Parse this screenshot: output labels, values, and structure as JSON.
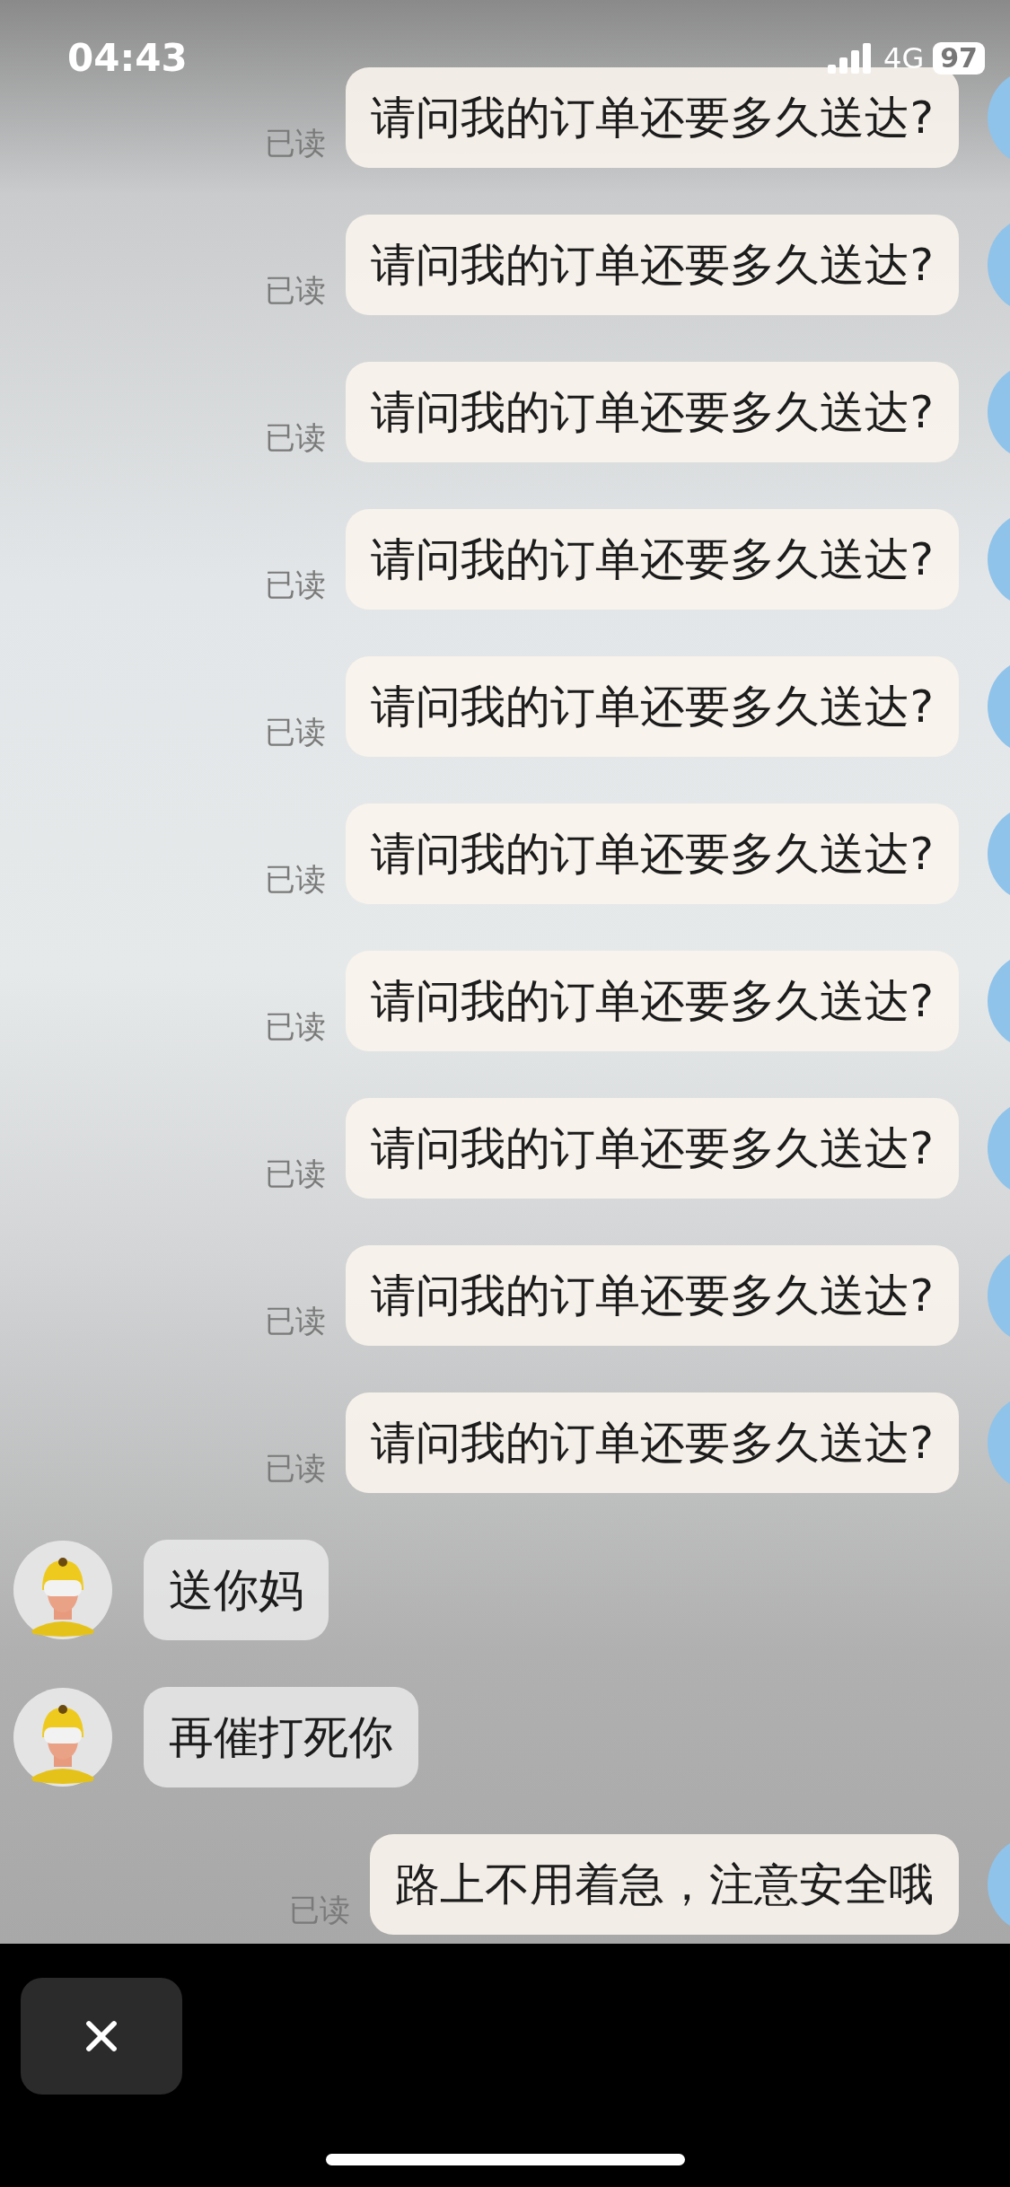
{
  "status_bar": {
    "time": "04:43",
    "network": "4G",
    "battery": "97"
  },
  "messages": [
    {
      "kind": "sent",
      "text": "请问我的订单还要多久送达?",
      "status": "已读"
    },
    {
      "kind": "sent",
      "text": "请问我的订单还要多久送达?",
      "status": "已读"
    },
    {
      "kind": "sent",
      "text": "请问我的订单还要多久送达?",
      "status": "已读"
    },
    {
      "kind": "sent",
      "text": "请问我的订单还要多久送达?",
      "status": "已读"
    },
    {
      "kind": "sent",
      "text": "请问我的订单还要多久送达?",
      "status": "已读"
    },
    {
      "kind": "sent",
      "text": "请问我的订单还要多久送达?",
      "status": "已读"
    },
    {
      "kind": "sent",
      "text": "请问我的订单还要多久送达?",
      "status": "已读"
    },
    {
      "kind": "sent",
      "text": "请问我的订单还要多久送达?",
      "status": "已读"
    },
    {
      "kind": "sent",
      "text": "请问我的订单还要多久送达?",
      "status": "已读"
    },
    {
      "kind": "sent",
      "text": "请问我的订单还要多久送达?",
      "status": "已读"
    },
    {
      "kind": "received",
      "text": "送你妈"
    },
    {
      "kind": "received",
      "text": "再催打死你"
    },
    {
      "kind": "sent",
      "text": "路上不用着急，注意安全哦",
      "status": "已读"
    }
  ]
}
